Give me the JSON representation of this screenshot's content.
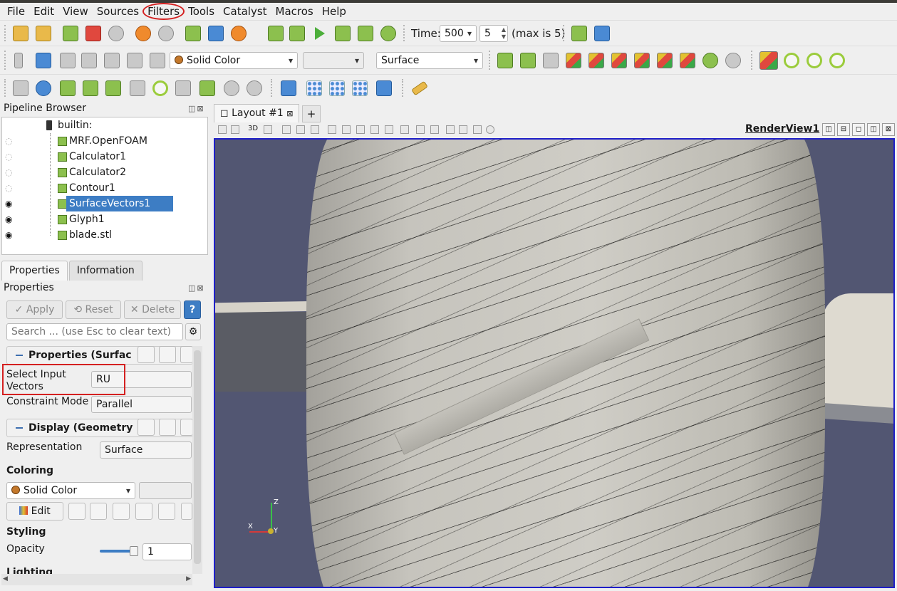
{
  "menu": [
    "File",
    "Edit",
    "View",
    "Sources",
    "Filters",
    "Tools",
    "Catalyst",
    "Macros",
    "Help"
  ],
  "time": {
    "label": "Time:",
    "value": "500",
    "step": "5",
    "max_text": "(max is 5)"
  },
  "toolbar2": {
    "coloring": "Solid Color",
    "component": "",
    "representation": "Surface",
    "view_labels": [
      "+X",
      "-X",
      "+Y",
      "-Y",
      "+Z",
      "-Z",
      "+90",
      "-90"
    ]
  },
  "pipeline": {
    "title": "Pipeline Browser",
    "root": "builtin:",
    "items": [
      {
        "label": "MRF.OpenFOAM",
        "visible": false
      },
      {
        "label": "Calculator1",
        "visible": false
      },
      {
        "label": "Calculator2",
        "visible": false
      },
      {
        "label": "Contour1",
        "visible": false
      },
      {
        "label": "SurfaceVectors1",
        "visible": true,
        "selected": true
      },
      {
        "label": "Glyph1",
        "visible": true
      },
      {
        "label": "blade.stl",
        "visible": true
      }
    ]
  },
  "tabs": [
    "Properties",
    "Information"
  ],
  "properties": {
    "title": "Properties",
    "apply": "Apply",
    "reset": "Reset",
    "delete": "Delete",
    "help": "?",
    "search_placeholder": "Search ... (use Esc to clear text)",
    "section1": "Properties (Surfac",
    "select_input_label": "Select Input Vectors",
    "select_input_value": "RU",
    "constraint_label": "Constraint Mode",
    "constraint_value": "Parallel",
    "section2": "Display (Geometry",
    "representation_label": "Representation",
    "representation_value": "Surface",
    "coloring_head": "Coloring",
    "coloring_value": "Solid Color",
    "edit": "Edit",
    "styling_head": "Styling",
    "opacity_label": "Opacity",
    "opacity_value": "1",
    "opacity_fraction": 1,
    "lighting_head": "Lighting"
  },
  "layout": {
    "tab": "Layout #1",
    "add": "+",
    "view_name": "RenderView1",
    "threed": "3D"
  },
  "axes": {
    "x": "X",
    "y": "Y",
    "z": "Z"
  }
}
